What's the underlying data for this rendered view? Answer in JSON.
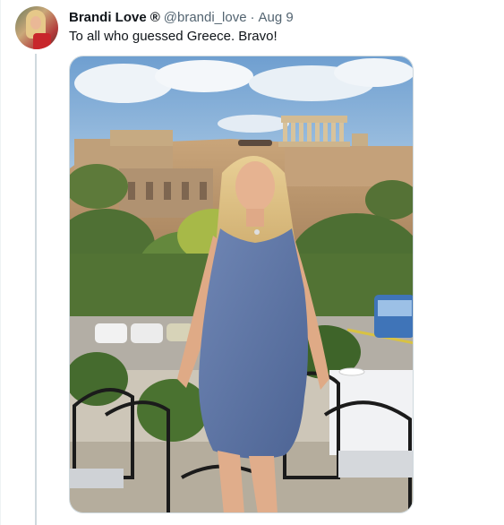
{
  "tweet": {
    "display_name": "Brandi Love",
    "registered_mark": "®",
    "handle": "@brandi_love",
    "separator": "·",
    "timestamp": "Aug 9",
    "text": "To all who guessed Greece. Bravo!"
  },
  "media": {
    "icon": "photo-icon"
  },
  "colors": {
    "text_primary": "#0f1419",
    "text_secondary": "#536471",
    "border": "#cfd9de"
  }
}
